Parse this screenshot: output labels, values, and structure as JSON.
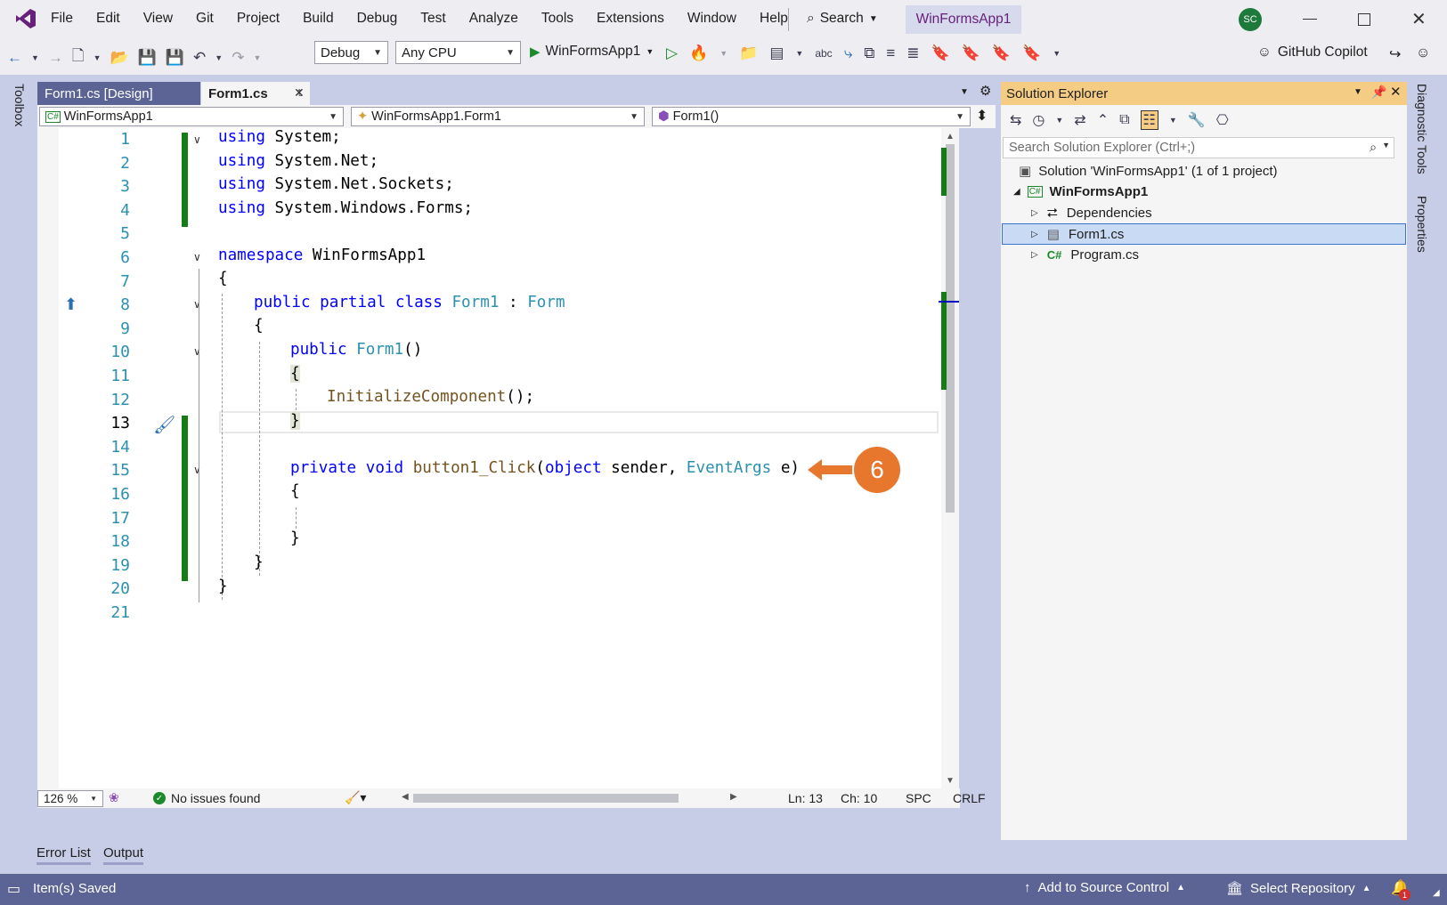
{
  "menu": {
    "items": [
      "File",
      "Edit",
      "View",
      "Git",
      "Project",
      "Build",
      "Debug",
      "Test",
      "Analyze",
      "Tools",
      "Extensions",
      "Window",
      "Help"
    ],
    "search": "Search",
    "solution_name": "WinFormsApp1",
    "avatar": "SC"
  },
  "toolbar": {
    "config": "Debug",
    "platform": "Any CPU",
    "start": "WinFormsApp1",
    "copilot": "GitHub Copilot"
  },
  "editor": {
    "tabs": [
      "Form1.cs [Design]",
      "Form1.cs"
    ],
    "nav": [
      "WinFormsApp1",
      "WinFormsApp1.Form1",
      "Form1()"
    ],
    "lines": [
      "1",
      "2",
      "3",
      "4",
      "5",
      "6",
      "7",
      "8",
      "9",
      "10",
      "11",
      "12",
      "13",
      "14",
      "15",
      "16",
      "17",
      "18",
      "19",
      "20",
      "21"
    ],
    "code": {
      "l1": [
        "using",
        " System;"
      ],
      "l2": [
        "using",
        " System.Net;"
      ],
      "l3": [
        "using",
        " System.Net.Sockets;"
      ],
      "l4": [
        "using",
        " System.Windows.Forms;"
      ],
      "l6": [
        "namespace",
        " WinFormsApp1"
      ],
      "brace": "{",
      "close": "}",
      "l8": [
        "public partial class ",
        "Form1",
        " : ",
        "Form"
      ],
      "l10": [
        "public ",
        "Form1",
        "()"
      ],
      "l12": [
        "InitializeComponent",
        "();"
      ],
      "l15": [
        "private void ",
        "button1_Click",
        "(",
        "object",
        " sender, ",
        "EventArgs",
        " e)"
      ]
    },
    "callout": "6",
    "zoom": "126 %",
    "issues": "No issues found",
    "status": {
      "ln": "Ln: 13",
      "ch": "Ch: 10",
      "spc": "SPC",
      "crlf": "CRLF"
    }
  },
  "side": {
    "toolbox": "Toolbox",
    "diagnostic": "Diagnostic Tools",
    "properties": "Properties"
  },
  "solution_explorer": {
    "title": "Solution Explorer",
    "search_placeholder": "Search Solution Explorer (Ctrl+;)",
    "solution": "Solution 'WinFormsApp1' (1 of 1 project)",
    "project": "WinFormsApp1",
    "items": [
      "Dependencies",
      "Form1.cs",
      "Program.cs"
    ]
  },
  "bottom": {
    "tabs": [
      "Error List",
      "Output"
    ],
    "status": "Item(s) Saved",
    "source_control": "Add to Source Control",
    "repo": "Select Repository",
    "notif_count": "1"
  },
  "colors": {
    "accent": "#68217a",
    "callout": "#e8772e",
    "selected": "#c9daf5",
    "explorer_header": "#f5cc84"
  }
}
